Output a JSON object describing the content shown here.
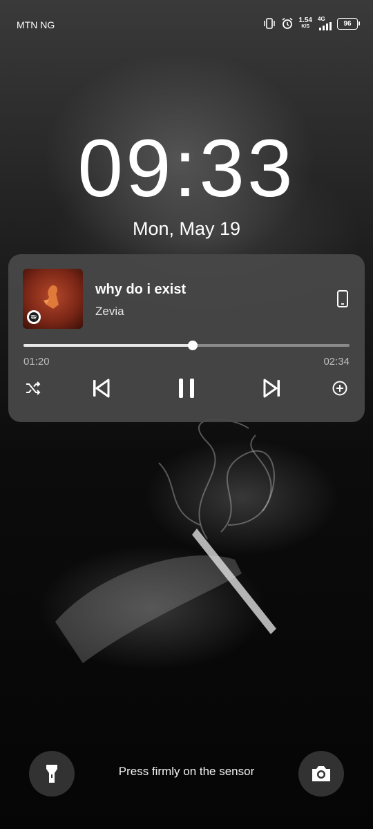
{
  "status_bar": {
    "carrier": "MTN NG",
    "speed_value": "1.54",
    "speed_unit": "K/S",
    "network": "4G",
    "battery": "96"
  },
  "lock": {
    "time": "09:33",
    "date": "Mon, May 19"
  },
  "media": {
    "title": "why do i exist",
    "artist": "Zevia",
    "elapsed": "01:20",
    "total": "02:34",
    "progress": 0.52
  },
  "bottom": {
    "hint": "Press firmly on the sensor"
  }
}
